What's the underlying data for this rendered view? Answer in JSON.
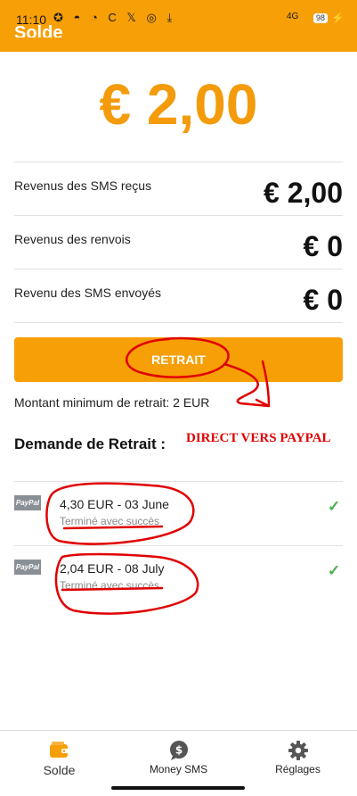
{
  "status": {
    "time": "11:10",
    "notif_icons": "✪ ◓ ◔ C 𝕏 ◎ ⤓",
    "network": "4G",
    "battery": "98"
  },
  "header": {
    "title": "Solde"
  },
  "balance": "€ 2,00",
  "income_rows": [
    {
      "label": "Revenus des SMS reçus",
      "value": "€ 2,00"
    },
    {
      "label": "Revenus des renvois",
      "value": "€ 0"
    },
    {
      "label": "Revenu des SMS envoyés",
      "value": "€ 0"
    }
  ],
  "withdraw_button": "RETRAIT",
  "min_withdraw": "Montant minimum de retrait: 2 EUR",
  "requests_title": "Demande de Retrait :",
  "annotation_text": "DIRECT VERS PAYPAL",
  "withdrawals": [
    {
      "method": "PayPal",
      "title": "4,30 EUR - 03 June",
      "status": "Terminé avec succès"
    },
    {
      "method": "PayPal",
      "title": "2,04 EUR - 08 July",
      "status": "Terminé avec succès"
    }
  ],
  "nav": [
    {
      "label": "Solde",
      "icon": "wallet-icon",
      "active": true
    },
    {
      "label": "Money SMS",
      "icon": "money-chat-icon",
      "active": false
    },
    {
      "label": "Réglages",
      "icon": "gear-icon",
      "active": false
    }
  ],
  "colors": {
    "accent": "#f79f06",
    "balance": "#f49b0c",
    "annotation": "#e00000",
    "check": "#4caf50"
  }
}
